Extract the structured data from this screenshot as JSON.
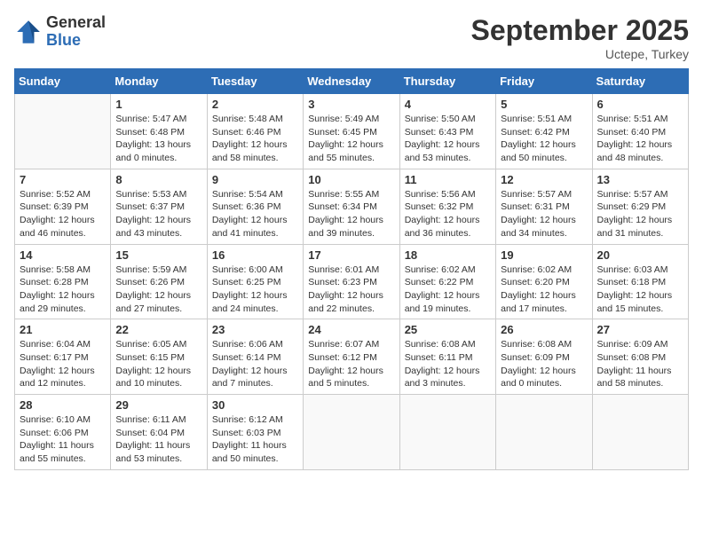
{
  "header": {
    "logo_general": "General",
    "logo_blue": "Blue",
    "month_title": "September 2025",
    "subtitle": "Uctepe, Turkey"
  },
  "days_of_week": [
    "Sunday",
    "Monday",
    "Tuesday",
    "Wednesday",
    "Thursday",
    "Friday",
    "Saturday"
  ],
  "weeks": [
    [
      {
        "day": "",
        "info": ""
      },
      {
        "day": "1",
        "info": "Sunrise: 5:47 AM\nSunset: 6:48 PM\nDaylight: 13 hours\nand 0 minutes."
      },
      {
        "day": "2",
        "info": "Sunrise: 5:48 AM\nSunset: 6:46 PM\nDaylight: 12 hours\nand 58 minutes."
      },
      {
        "day": "3",
        "info": "Sunrise: 5:49 AM\nSunset: 6:45 PM\nDaylight: 12 hours\nand 55 minutes."
      },
      {
        "day": "4",
        "info": "Sunrise: 5:50 AM\nSunset: 6:43 PM\nDaylight: 12 hours\nand 53 minutes."
      },
      {
        "day": "5",
        "info": "Sunrise: 5:51 AM\nSunset: 6:42 PM\nDaylight: 12 hours\nand 50 minutes."
      },
      {
        "day": "6",
        "info": "Sunrise: 5:51 AM\nSunset: 6:40 PM\nDaylight: 12 hours\nand 48 minutes."
      }
    ],
    [
      {
        "day": "7",
        "info": "Sunrise: 5:52 AM\nSunset: 6:39 PM\nDaylight: 12 hours\nand 46 minutes."
      },
      {
        "day": "8",
        "info": "Sunrise: 5:53 AM\nSunset: 6:37 PM\nDaylight: 12 hours\nand 43 minutes."
      },
      {
        "day": "9",
        "info": "Sunrise: 5:54 AM\nSunset: 6:36 PM\nDaylight: 12 hours\nand 41 minutes."
      },
      {
        "day": "10",
        "info": "Sunrise: 5:55 AM\nSunset: 6:34 PM\nDaylight: 12 hours\nand 39 minutes."
      },
      {
        "day": "11",
        "info": "Sunrise: 5:56 AM\nSunset: 6:32 PM\nDaylight: 12 hours\nand 36 minutes."
      },
      {
        "day": "12",
        "info": "Sunrise: 5:57 AM\nSunset: 6:31 PM\nDaylight: 12 hours\nand 34 minutes."
      },
      {
        "day": "13",
        "info": "Sunrise: 5:57 AM\nSunset: 6:29 PM\nDaylight: 12 hours\nand 31 minutes."
      }
    ],
    [
      {
        "day": "14",
        "info": "Sunrise: 5:58 AM\nSunset: 6:28 PM\nDaylight: 12 hours\nand 29 minutes."
      },
      {
        "day": "15",
        "info": "Sunrise: 5:59 AM\nSunset: 6:26 PM\nDaylight: 12 hours\nand 27 minutes."
      },
      {
        "day": "16",
        "info": "Sunrise: 6:00 AM\nSunset: 6:25 PM\nDaylight: 12 hours\nand 24 minutes."
      },
      {
        "day": "17",
        "info": "Sunrise: 6:01 AM\nSunset: 6:23 PM\nDaylight: 12 hours\nand 22 minutes."
      },
      {
        "day": "18",
        "info": "Sunrise: 6:02 AM\nSunset: 6:22 PM\nDaylight: 12 hours\nand 19 minutes."
      },
      {
        "day": "19",
        "info": "Sunrise: 6:02 AM\nSunset: 6:20 PM\nDaylight: 12 hours\nand 17 minutes."
      },
      {
        "day": "20",
        "info": "Sunrise: 6:03 AM\nSunset: 6:18 PM\nDaylight: 12 hours\nand 15 minutes."
      }
    ],
    [
      {
        "day": "21",
        "info": "Sunrise: 6:04 AM\nSunset: 6:17 PM\nDaylight: 12 hours\nand 12 minutes."
      },
      {
        "day": "22",
        "info": "Sunrise: 6:05 AM\nSunset: 6:15 PM\nDaylight: 12 hours\nand 10 minutes."
      },
      {
        "day": "23",
        "info": "Sunrise: 6:06 AM\nSunset: 6:14 PM\nDaylight: 12 hours\nand 7 minutes."
      },
      {
        "day": "24",
        "info": "Sunrise: 6:07 AM\nSunset: 6:12 PM\nDaylight: 12 hours\nand 5 minutes."
      },
      {
        "day": "25",
        "info": "Sunrise: 6:08 AM\nSunset: 6:11 PM\nDaylight: 12 hours\nand 3 minutes."
      },
      {
        "day": "26",
        "info": "Sunrise: 6:08 AM\nSunset: 6:09 PM\nDaylight: 12 hours\nand 0 minutes."
      },
      {
        "day": "27",
        "info": "Sunrise: 6:09 AM\nSunset: 6:08 PM\nDaylight: 11 hours\nand 58 minutes."
      }
    ],
    [
      {
        "day": "28",
        "info": "Sunrise: 6:10 AM\nSunset: 6:06 PM\nDaylight: 11 hours\nand 55 minutes."
      },
      {
        "day": "29",
        "info": "Sunrise: 6:11 AM\nSunset: 6:04 PM\nDaylight: 11 hours\nand 53 minutes."
      },
      {
        "day": "30",
        "info": "Sunrise: 6:12 AM\nSunset: 6:03 PM\nDaylight: 11 hours\nand 50 minutes."
      },
      {
        "day": "",
        "info": ""
      },
      {
        "day": "",
        "info": ""
      },
      {
        "day": "",
        "info": ""
      },
      {
        "day": "",
        "info": ""
      }
    ]
  ]
}
